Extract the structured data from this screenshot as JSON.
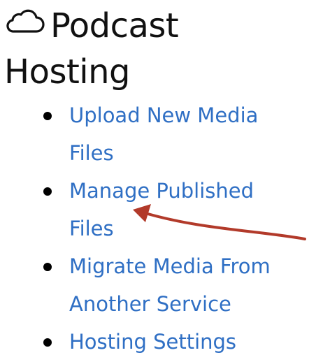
{
  "header": {
    "icon": "cloud-icon",
    "title": "Podcast Hosting"
  },
  "menu": {
    "items": [
      {
        "label": "Upload New Media Files"
      },
      {
        "label": "Manage Published Files"
      },
      {
        "label": "Migrate Media From Another Service"
      },
      {
        "label": "Hosting Settings"
      }
    ]
  },
  "annotation": {
    "type": "arrow",
    "color": "#b23a2a",
    "points_to": "Manage Published Files"
  },
  "colors": {
    "link": "#2f6fc4",
    "text": "#111111",
    "bullet": "#000000"
  }
}
